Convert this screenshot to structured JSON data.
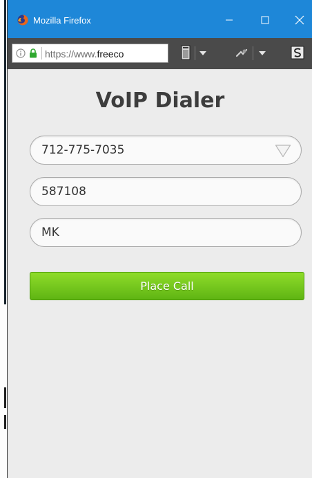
{
  "window": {
    "title": "Mozilla Firefox"
  },
  "addressbar": {
    "url_prefix": "https://www.",
    "url_host": "freeco"
  },
  "page": {
    "heading": "VoIP Dialer",
    "number_select": {
      "value": "712-775-7035"
    },
    "pin_field": {
      "value": "587108"
    },
    "name_field": {
      "value": "MK"
    },
    "call_button": {
      "label": "Place Call"
    }
  },
  "colors": {
    "titlebar": "#1e87d8",
    "toolbar": "#4a4a4a",
    "page_bg": "#ececec",
    "button_green": "#6cc51a"
  },
  "icons": [
    "firefox-icon",
    "minimize-icon",
    "maximize-icon",
    "close-icon",
    "info-icon",
    "lock-icon",
    "reader-icon",
    "dropdown-arrow-icon",
    "pocket-icon",
    "menu-arrow-icon",
    "s-icon"
  ]
}
